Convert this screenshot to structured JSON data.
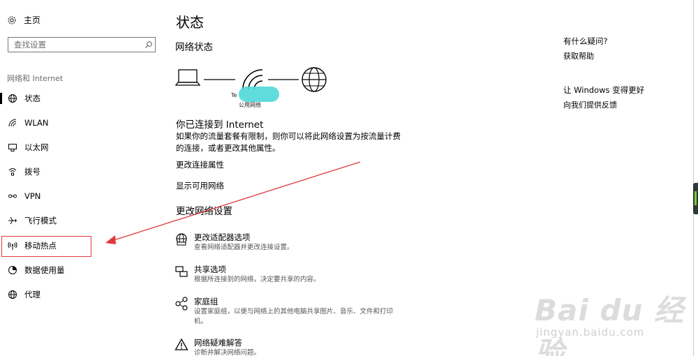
{
  "sidebar": {
    "home_label": "主页",
    "search_placeholder": "查找设置",
    "section_title": "网络和 Internet",
    "items": [
      {
        "label": "状态",
        "icon": "status-globe-icon"
      },
      {
        "label": "WLAN",
        "icon": "wifi-icon"
      },
      {
        "label": "以太网",
        "icon": "ethernet-icon"
      },
      {
        "label": "拨号",
        "icon": "dialup-icon"
      },
      {
        "label": "VPN",
        "icon": "vpn-icon"
      },
      {
        "label": "飞行模式",
        "icon": "airplane-icon"
      },
      {
        "label": "移动热点",
        "icon": "hotspot-icon"
      },
      {
        "label": "数据使用量",
        "icon": "data-usage-icon"
      },
      {
        "label": "代理",
        "icon": "proxy-globe-icon"
      }
    ]
  },
  "main": {
    "title": "状态",
    "network_status_heading": "网络状态",
    "diagram": {
      "network_name": "Te",
      "network_type": "公用网络"
    },
    "connected_heading": "你已连接到 Internet",
    "connected_desc": "如果你的流量套餐有限制，则你可以将此网络设置为按流量计费的连接，或者更改其他属性。",
    "links": [
      "更改连接属性",
      "显示可用网络"
    ],
    "change_heading": "更改网络设置",
    "options": [
      {
        "title": "更改适配器选项",
        "sub": "查看网络适配器并更改连接设置。",
        "icon": "adapter-icon"
      },
      {
        "title": "共享选项",
        "sub": "根据所连接到的网络，决定要共享的内容。",
        "icon": "sharing-icon"
      },
      {
        "title": "家庭组",
        "sub": "设置家庭组，以便与网络上的其他电脑共享图片、音乐、文件和打印机。",
        "icon": "homegroup-icon"
      },
      {
        "title": "网络疑难解答",
        "sub": "诊断并解决网络问题。",
        "icon": "warning-icon"
      }
    ]
  },
  "right": {
    "help_heading": "有什么疑问?",
    "help_link": "获取帮助",
    "improve_heading": "让 Windows 变得更好",
    "feedback_link": "向我们提供反馈"
  },
  "watermark": {
    "main": "Bai du 经验",
    "sub": "jingyan.baidu.com"
  },
  "colors": {
    "annotation": "#e0393b",
    "teal_mark": "#4fd8d8"
  }
}
